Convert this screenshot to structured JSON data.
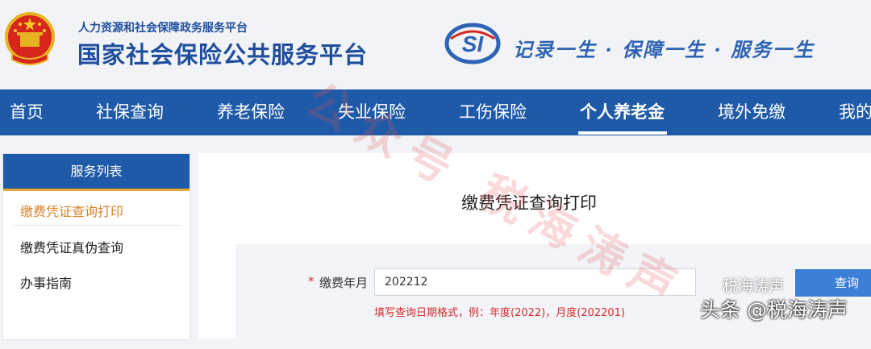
{
  "header": {
    "subtitle": "人力资源和社会保障政务服务平台",
    "title": "国家社会保险公共服务平台",
    "si_logo_text": "SI",
    "slogan": "记录一生 · 保障一生 · 服务一生"
  },
  "nav": {
    "items": [
      {
        "label": "首页"
      },
      {
        "label": "社保查询"
      },
      {
        "label": "养老保险"
      },
      {
        "label": "失业保险"
      },
      {
        "label": "工伤保险"
      },
      {
        "label": "个人养老金"
      },
      {
        "label": "境外免缴"
      },
      {
        "label": "我的"
      }
    ],
    "active_label": "个人养老金"
  },
  "sidebar": {
    "header": "服务列表",
    "items": [
      {
        "label": "缴费凭证查询打印"
      },
      {
        "label": "缴费凭证真伪查询"
      },
      {
        "label": "办事指南"
      }
    ]
  },
  "main": {
    "title": "缴费凭证查询打印",
    "form": {
      "required_mark": "*",
      "label": "缴费年月",
      "value": "202212",
      "hint": "填写查询日期格式，例：年度(2022)，月度(202201)",
      "submit_label": "查询"
    }
  },
  "watermark": {
    "text": "公众号 税海涛声",
    "badge": "头条 @税海涛声",
    "badge_small": "税海涛声"
  },
  "colors": {
    "brand_blue": "#1f5aa8",
    "accent_orange": "#e8a534",
    "hint_red": "#d62b2b",
    "button_blue": "#3b7fd9"
  }
}
